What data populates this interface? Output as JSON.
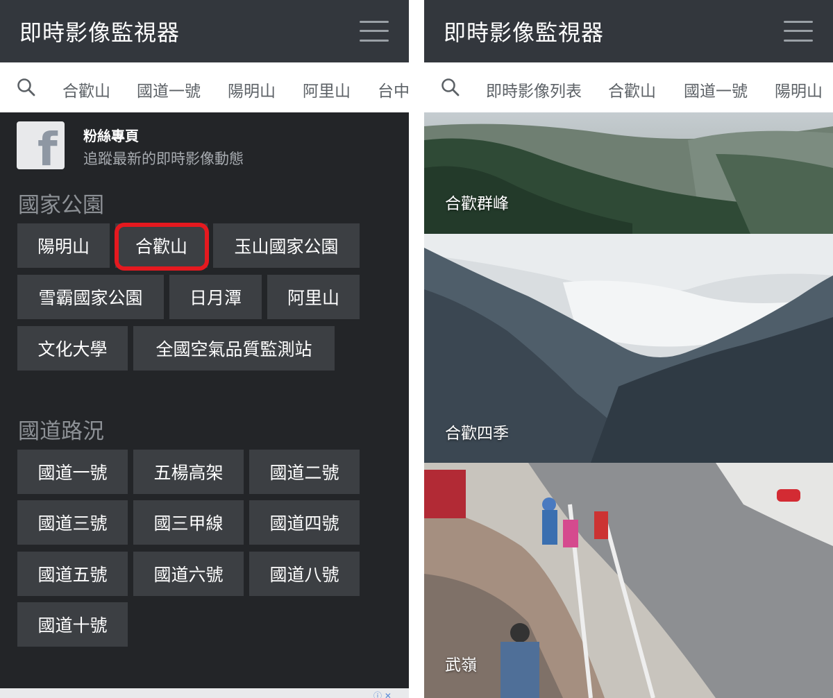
{
  "left": {
    "app_title": "即時影像監視器",
    "tabs": [
      "合歡山",
      "國道一號",
      "陽明山",
      "阿里山",
      "台中"
    ],
    "facebook": {
      "title": "粉絲專頁",
      "subtitle": "追蹤最新的即時影像動態",
      "logo_letter": "f"
    },
    "sections": [
      {
        "title": "國家公園",
        "items": [
          "陽明山",
          "合歡山",
          "玉山國家公園",
          "雪霸國家公園",
          "日月潭",
          "阿里山",
          "文化大學",
          "全國空氣品質監測站"
        ],
        "highlighted": "合歡山"
      },
      {
        "title": "國道路況",
        "items": [
          "國道一號",
          "五楊高架",
          "國道二號",
          "國道三號",
          "國三甲線",
          "國道四號",
          "國道五號",
          "國道六號",
          "國道八號",
          "國道十號"
        ]
      }
    ]
  },
  "right": {
    "app_title": "即時影像監視器",
    "tabs": [
      "即時影像列表",
      "合歡山",
      "國道一號",
      "陽明山"
    ],
    "cameras": [
      {
        "label": "合歡群峰"
      },
      {
        "label": "合歡四季"
      },
      {
        "label": "武嶺"
      }
    ]
  },
  "colors": {
    "appbar": "#33373d",
    "panel": "#232528",
    "chip": "#3c3f43",
    "highlight": "#e5191f"
  },
  "icons": {
    "search": "search-icon",
    "menu": "hamburger-menu-icon",
    "facebook": "facebook-icon"
  }
}
